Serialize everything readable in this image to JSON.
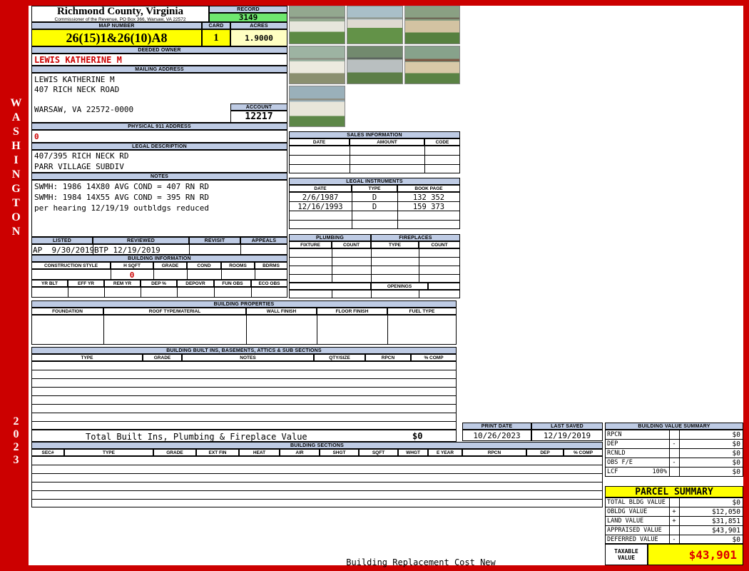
{
  "colors": {
    "frame_red": "#cc0000",
    "header_blue": "#becbe4",
    "record_green": "#6fe86f",
    "highlight_yellow": "#ffff00",
    "acres_cream": "#ffffc2",
    "alert_red": "#cc0000"
  },
  "sidebar": {
    "district": "WASHINGTON",
    "year": "2023"
  },
  "county": {
    "title": "Richmond County, Virginia",
    "subtitle": "Commissioner of the Revenue, PO Box 366, Warsaw, VA 22572"
  },
  "record": {
    "label": "RECORD",
    "value": "3149"
  },
  "map_number": {
    "label": "MAP NUMBER",
    "value": "26(15)1&26(10)A8"
  },
  "card": {
    "label": "CARD",
    "value": "1"
  },
  "acres": {
    "label": "ACRES",
    "value": "1.9000"
  },
  "deeded_owner": {
    "label": "DEEDED OWNER",
    "value": "LEWIS KATHERINE M"
  },
  "mailing": {
    "label": "MAILING ADDRESS",
    "line1": "LEWIS KATHERINE M",
    "line2": "407 RICH NECK ROAD",
    "line3": "WARSAW, VA 22572-0000"
  },
  "account": {
    "label": "ACCOUNT",
    "value": "12217"
  },
  "physical_911": {
    "label": "PHYSICAL 911 ADDRESS",
    "value": "0"
  },
  "legal_description": {
    "label": "LEGAL DESCRIPTION",
    "line1": "407/395 RICH NECK RD",
    "line2": "PARR VILLAGE SUBDIV"
  },
  "notes": {
    "label": "NOTES",
    "line1": "SWMH: 1986 14X80 AVG COND = 407 RN RD",
    "line2": "SWMH: 1984 14X55 AVG COND = 395 RN RD",
    "line3": "per hearing 12/19/19 outbldgs reduced"
  },
  "review": {
    "headers": [
      "LISTED",
      "REVIEWED",
      "REVISIT",
      "APPEALS"
    ],
    "listed_value": "AP  9/30/2019",
    "reviewed_value": "BTP 12/19/2019"
  },
  "building_information": {
    "label": "BUILDING INFORMATION",
    "row1_headers": [
      "CONSTRUCTION STYLE",
      "H SQFT",
      "GRADE",
      "COND",
      "ROOMS",
      "BDRMS"
    ],
    "h_sqft_value": "0",
    "row2_headers": [
      "YR BLT",
      "EFF YR",
      "REM YR",
      "DEP %",
      "DEPOVR",
      "FUN OBS",
      "ECO OBS"
    ]
  },
  "building_properties": {
    "label": "BUILDING PROPERTIES",
    "headers": [
      "FOUNDATION",
      "ROOF TYPE/MATERIAL",
      "WALL FINISH",
      "FLOOR FINISH",
      "FUEL TYPE"
    ]
  },
  "built_ins": {
    "label": "BUILDING BUILT INS, BASEMENTS, ATTICS & SUB SECTIONS",
    "headers": [
      "TYPE",
      "GRADE",
      "NOTES",
      "QTY/SIZE",
      "RPCN",
      "% COMP"
    ],
    "total_label": "Total Built Ins, Plumbing & Fireplace Value",
    "total_value": "$0"
  },
  "building_sections": {
    "label": "BUILDING SECTIONS",
    "headers": [
      "SEC#",
      "TYPE",
      "GRADE",
      "EXT FIN",
      "HEAT",
      "AIR",
      "SHGT",
      "SQFT",
      "WHGT",
      "E YEAR",
      "RPCN",
      "DEP",
      "% COMP"
    ]
  },
  "sales_information": {
    "label": "SALES INFORMATION",
    "headers": [
      "DATE",
      "AMOUNT",
      "CODE"
    ]
  },
  "legal_instruments": {
    "label": "LEGAL INSTRUMENTS",
    "headers": [
      "DATE",
      "TYPE",
      "BOOK PAGE"
    ],
    "rows": [
      [
        "2/6/1987",
        "D",
        "132 352"
      ],
      [
        "12/16/1993",
        "D",
        "159 373"
      ]
    ]
  },
  "plumbing": {
    "label": "PLUMBING",
    "headers": [
      "FIXTURE",
      "COUNT"
    ]
  },
  "fireplaces": {
    "label": "FIREPLACES",
    "headers": [
      "TYPE",
      "COUNT"
    ],
    "openings_label": "OPENINGS"
  },
  "photos": {
    "count": 7
  },
  "print_info": {
    "print_date_label": "PRINT DATE",
    "print_date": "10/26/2023",
    "last_saved_label": "LAST SAVED",
    "last_saved": "12/19/2019"
  },
  "building_value_summary": {
    "label": "BUILDING VALUE SUMMARY",
    "rows": [
      {
        "label": "RPCN",
        "op": "",
        "value": "$0"
      },
      {
        "label": "DEP",
        "op": "-",
        "value": "$0"
      },
      {
        "label": "RCNLD",
        "op": "",
        "value": "$0"
      },
      {
        "label": "OBS F/E",
        "op": "-",
        "value": "$0"
      },
      {
        "label": "LCF",
        "mid": "100%",
        "op": "",
        "value": "$0"
      }
    ]
  },
  "parcel_summary": {
    "label": "PARCEL SUMMARY",
    "rows": [
      {
        "label": "TOTAL BLDG VALUE",
        "op": "",
        "value": "$0"
      },
      {
        "label": "OBLDG VALUE",
        "op": "+",
        "value": "$12,050"
      },
      {
        "label": "LAND VALUE",
        "op": "+",
        "value": "$31,851"
      },
      {
        "label": "APPRAISED VALUE",
        "op": "",
        "value": "$43,901"
      },
      {
        "label": "DEFERRED VALUE",
        "op": "-",
        "value": "$0"
      }
    ],
    "taxable_label": "TAXABLE VALUE",
    "taxable_value": "$43,901"
  },
  "footer": {
    "text": "Building Replacement Cost New"
  }
}
